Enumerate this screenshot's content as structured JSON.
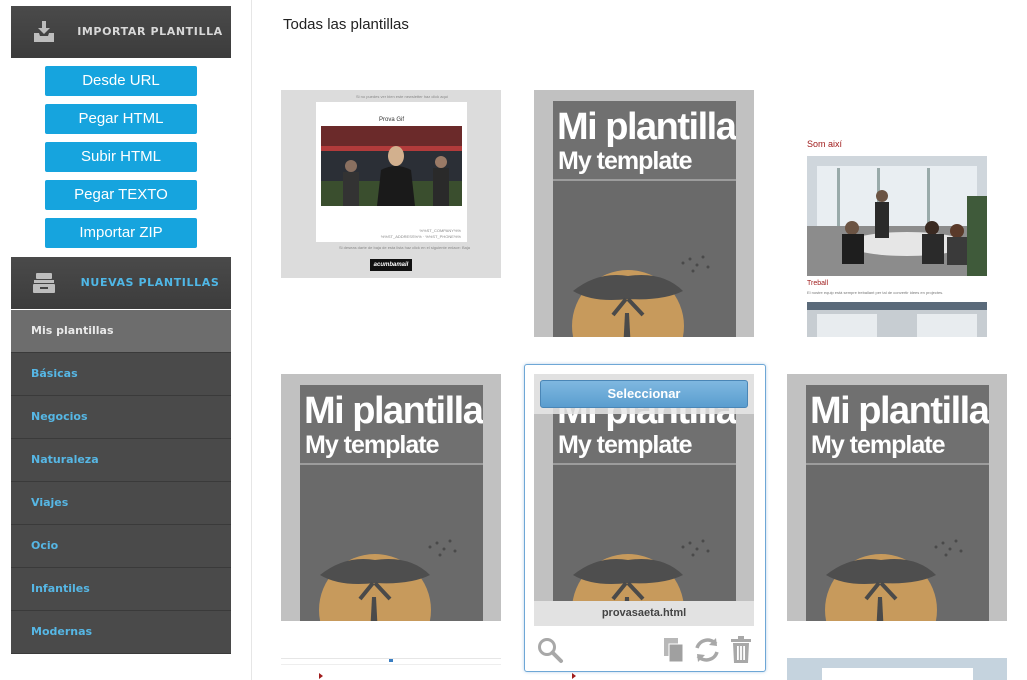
{
  "sidebar": {
    "import_title": "IMPORTAR PLANTILLA",
    "import_buttons": [
      "Desde URL",
      "Pegar HTML",
      "Subir HTML",
      "Pegar TEXTO",
      "Importar ZIP"
    ],
    "new_title": "NUEVAS PLANTILLAS",
    "categories": [
      "Mis plantillas",
      "Básicas",
      "Negocios",
      "Naturaleza",
      "Viajes",
      "Ocio",
      "Infantiles",
      "Modernas"
    ],
    "active_category": "Mis plantillas"
  },
  "main": {
    "title": "Todas las plantillas",
    "template_heading": "Mi plantilla",
    "template_subheading": "My template",
    "email_preview": {
      "header_note": "Si no puedes ver bien este newsletter haz click aquí",
      "heading": "Prova Gif",
      "company": "%%ST_COMPANY%%",
      "address": "%%ST_ADDRESS%% · %%ST_PHONE%%",
      "footer_note": "Si deseas darte de baja de esta lista haz click en el siguiente enlace: Baja",
      "badge": "acumbamail"
    },
    "photo_preview": {
      "caption1": "Som així",
      "caption2": "Treball",
      "small_text": "El nostre equip està sempre treballant per tal de convertir idees en projectes."
    },
    "selected": {
      "select_label": "Seleccionar",
      "filename": "provasaeta.html"
    }
  },
  "colors": {
    "accent_blue": "#16a4de",
    "sidebar_dark": "#4a4a4a",
    "category_text": "#56b7e5",
    "sun": "#c79a5c",
    "template_gray": "#6a6a6a"
  },
  "icons": {
    "import": "inbox-download-icon",
    "new": "drawer-icon",
    "preview": "search-icon",
    "duplicate": "copy-icon",
    "refresh": "refresh-icon",
    "delete": "trash-icon"
  }
}
